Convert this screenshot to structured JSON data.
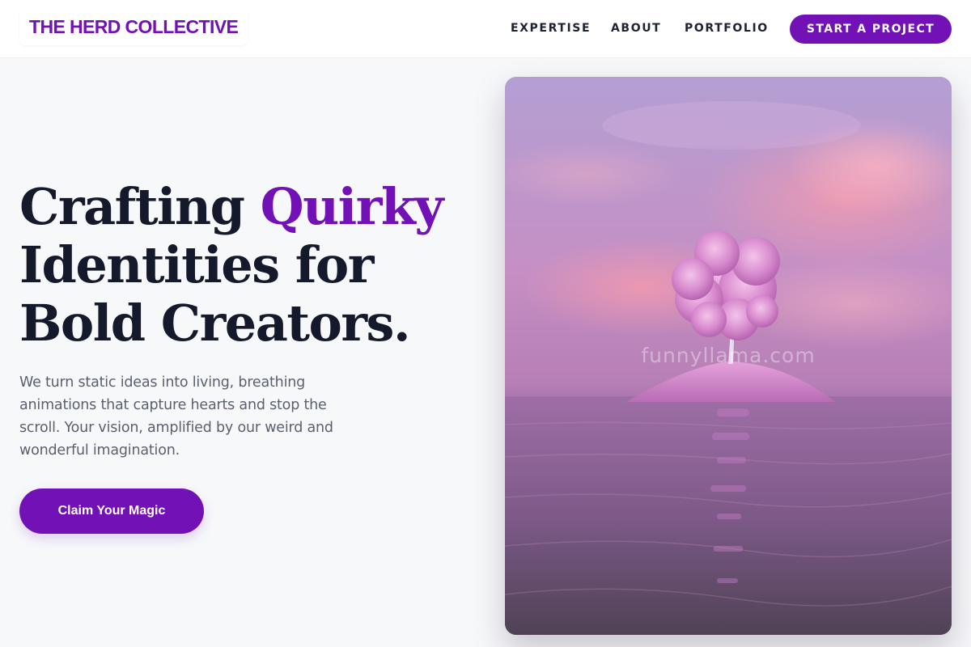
{
  "header": {
    "logo": "THE HERD COLLECTIVE",
    "nav": [
      {
        "label": "EXPERTISE"
      },
      {
        "label": "ABOUT"
      },
      {
        "label": "PORTFOLIO"
      }
    ],
    "cta_label": "START A PROJECT"
  },
  "hero": {
    "title_line1_plain": "Crafting ",
    "title_line1_accent": "Quirky",
    "title_line2": "Identities for",
    "title_line3": "Bold Creators.",
    "body": "We turn static ideas into living, breathing animations that capture hearts and stop the scroll. Your vision, amplified by our weird and wonderful imagination.",
    "cta_label": "Claim Your Magic"
  },
  "image": {
    "subject": "pink-tree-island-on-water",
    "watermark": "funnyllama.com"
  },
  "colors": {
    "accent": "#7211b5",
    "heading": "#141a2b",
    "body_text": "#5b6070",
    "page_bg": "#f7f8fa"
  }
}
